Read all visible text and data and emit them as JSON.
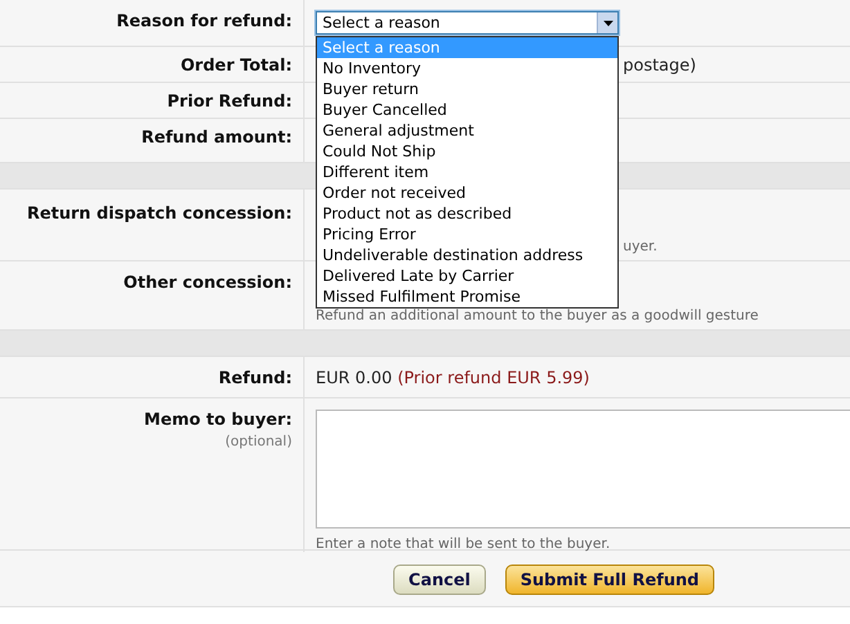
{
  "reason": {
    "label": "Reason for refund:",
    "value": "Select a reason",
    "expanded": true,
    "options": [
      {
        "label": "Select a reason",
        "selected": true
      },
      {
        "label": "No Inventory",
        "selected": false
      },
      {
        "label": "Buyer return",
        "selected": false
      },
      {
        "label": "Buyer Cancelled",
        "selected": false
      },
      {
        "label": "General adjustment",
        "selected": false
      },
      {
        "label": "Could Not Ship",
        "selected": false
      },
      {
        "label": "Different item",
        "selected": false
      },
      {
        "label": "Order not received",
        "selected": false
      },
      {
        "label": "Product not as described",
        "selected": false
      },
      {
        "label": "Pricing Error",
        "selected": false
      },
      {
        "label": "Undeliverable destination address",
        "selected": false
      },
      {
        "label": "Delivered Late by Carrier",
        "selected": false
      },
      {
        "label": "Missed Fulfilment Promise",
        "selected": false
      }
    ]
  },
  "top_rows": [
    {
      "label": "Order Total:",
      "value": "postage)"
    },
    {
      "label": "Prior Refund:"
    },
    {
      "label": "Refund amount:"
    }
  ],
  "concessions": [
    {
      "label": "Return dispatch concession:",
      "hint": "uyer."
    },
    {
      "label": "Other concession:",
      "hint": "Refund an additional amount to the buyer as a goodwill gesture"
    }
  ],
  "refund": {
    "label": "Refund:",
    "amount": "EUR 0.00",
    "prior": "(Prior refund EUR 5.99)"
  },
  "memo": {
    "label": "Memo to buyer:",
    "optional": "(optional)",
    "hint": "Enter a note that will be sent to the buyer."
  },
  "buttons": [
    {
      "label": "Cancel",
      "kind": "secondary"
    },
    {
      "label": "Submit Full Refund",
      "kind": "primary"
    }
  ]
}
